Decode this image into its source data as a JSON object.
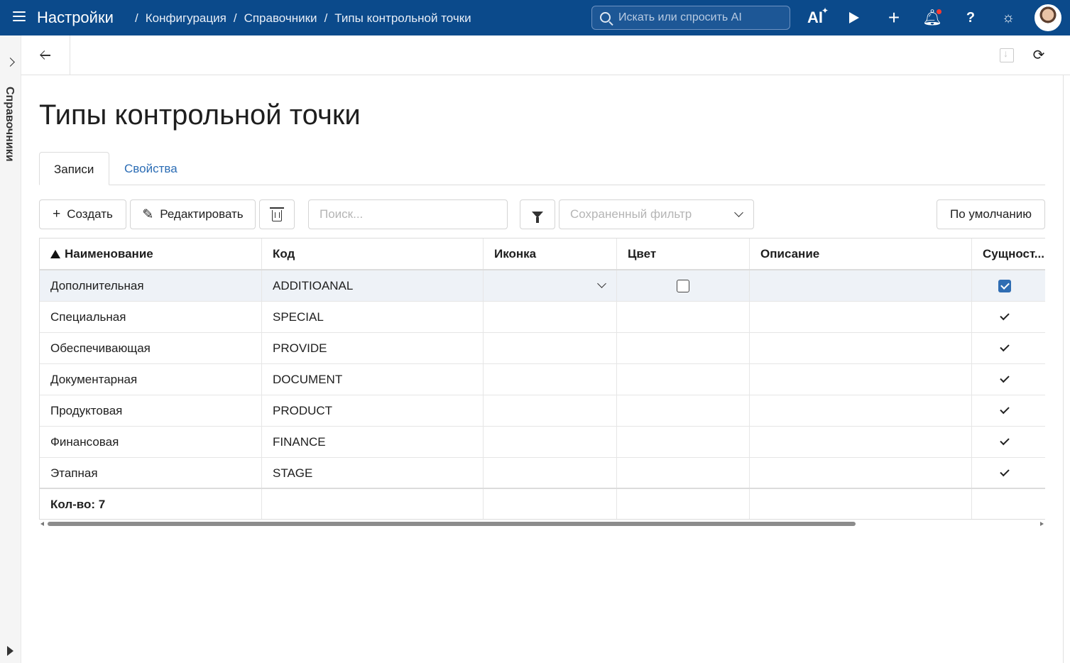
{
  "topbar": {
    "app_title": "Настройки",
    "breadcrumb": [
      "Конфигурация",
      "Справочники",
      "Типы контрольной точки"
    ],
    "breadcrumb_sep": "/",
    "search_placeholder": "Искать или спросить AI",
    "ai_label": "AI",
    "icons": [
      "menu-icon",
      "ai-icon",
      "play-icon",
      "plus-icon",
      "bell-icon",
      "help-icon",
      "sun-icon",
      "avatar"
    ],
    "notification_dot_color": "#ff3b30",
    "bar_color": "#0b4a8b"
  },
  "leftpanel": {
    "label": "Справочники"
  },
  "page": {
    "title": "Типы контрольной точки"
  },
  "tabs": [
    {
      "label": "Записи",
      "active": true
    },
    {
      "label": "Свойства",
      "active": false
    }
  ],
  "actions": {
    "create_label": "Создать",
    "edit_label": "Редактировать",
    "search_placeholder": "Поиск...",
    "saved_filter_placeholder": "Сохраненный фильтр",
    "default_label": "По умолчанию"
  },
  "grid": {
    "columns": [
      "Наименование",
      "Код",
      "Иконка",
      "Цвет",
      "Описание",
      "Сущност..."
    ],
    "sorted_column": "Наименование",
    "sort_direction": "ascending",
    "rows": [
      {
        "name": "Дополнительная",
        "code": "ADDITIOANAL",
        "icon": "",
        "color": "",
        "description": "",
        "entity": true,
        "selected": true
      },
      {
        "name": "Специальная",
        "code": "SPECIAL",
        "icon": "",
        "color": "",
        "description": "",
        "entity": true,
        "selected": false
      },
      {
        "name": "Обеспечивающая",
        "code": "PROVIDE",
        "icon": "",
        "color": "",
        "description": "",
        "entity": true,
        "selected": false
      },
      {
        "name": "Документарная",
        "code": "DOCUMENT",
        "icon": "",
        "color": "",
        "description": "",
        "entity": true,
        "selected": false
      },
      {
        "name": "Продуктовая",
        "code": "PRODUCT",
        "icon": "",
        "color": "",
        "description": "",
        "entity": true,
        "selected": false
      },
      {
        "name": "Финансовая",
        "code": "FINANCE",
        "icon": "",
        "color": "",
        "description": "",
        "entity": true,
        "selected": false
      },
      {
        "name": "Этапная",
        "code": "STAGE",
        "icon": "",
        "color": "",
        "description": "",
        "entity": true,
        "selected": false
      }
    ],
    "footer": {
      "count_label": "Кол-во: 7"
    }
  },
  "colors": {
    "accent": "#2f6db3",
    "link": "#2c6db5"
  }
}
